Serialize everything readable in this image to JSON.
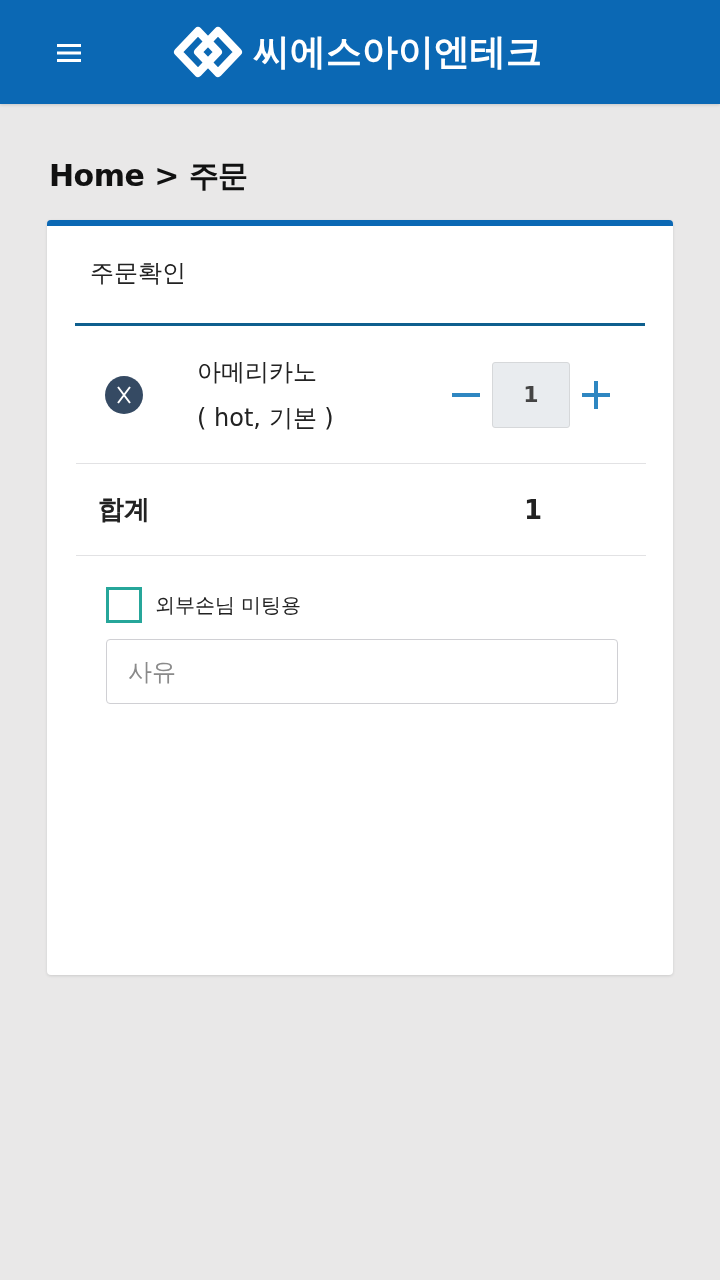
{
  "header": {
    "brand": "씨에스아이엔테크"
  },
  "breadcrumb": "Home > 주문",
  "card": {
    "title": "주문확인",
    "items": [
      {
        "name": "아메리카노",
        "options": "( hot, 기본 )",
        "quantity": "1"
      }
    ],
    "total": {
      "label": "합계",
      "value": "1"
    },
    "checkbox": {
      "label": "외부손님 미팅용",
      "checked": false
    },
    "reason": {
      "placeholder": "사유"
    }
  }
}
